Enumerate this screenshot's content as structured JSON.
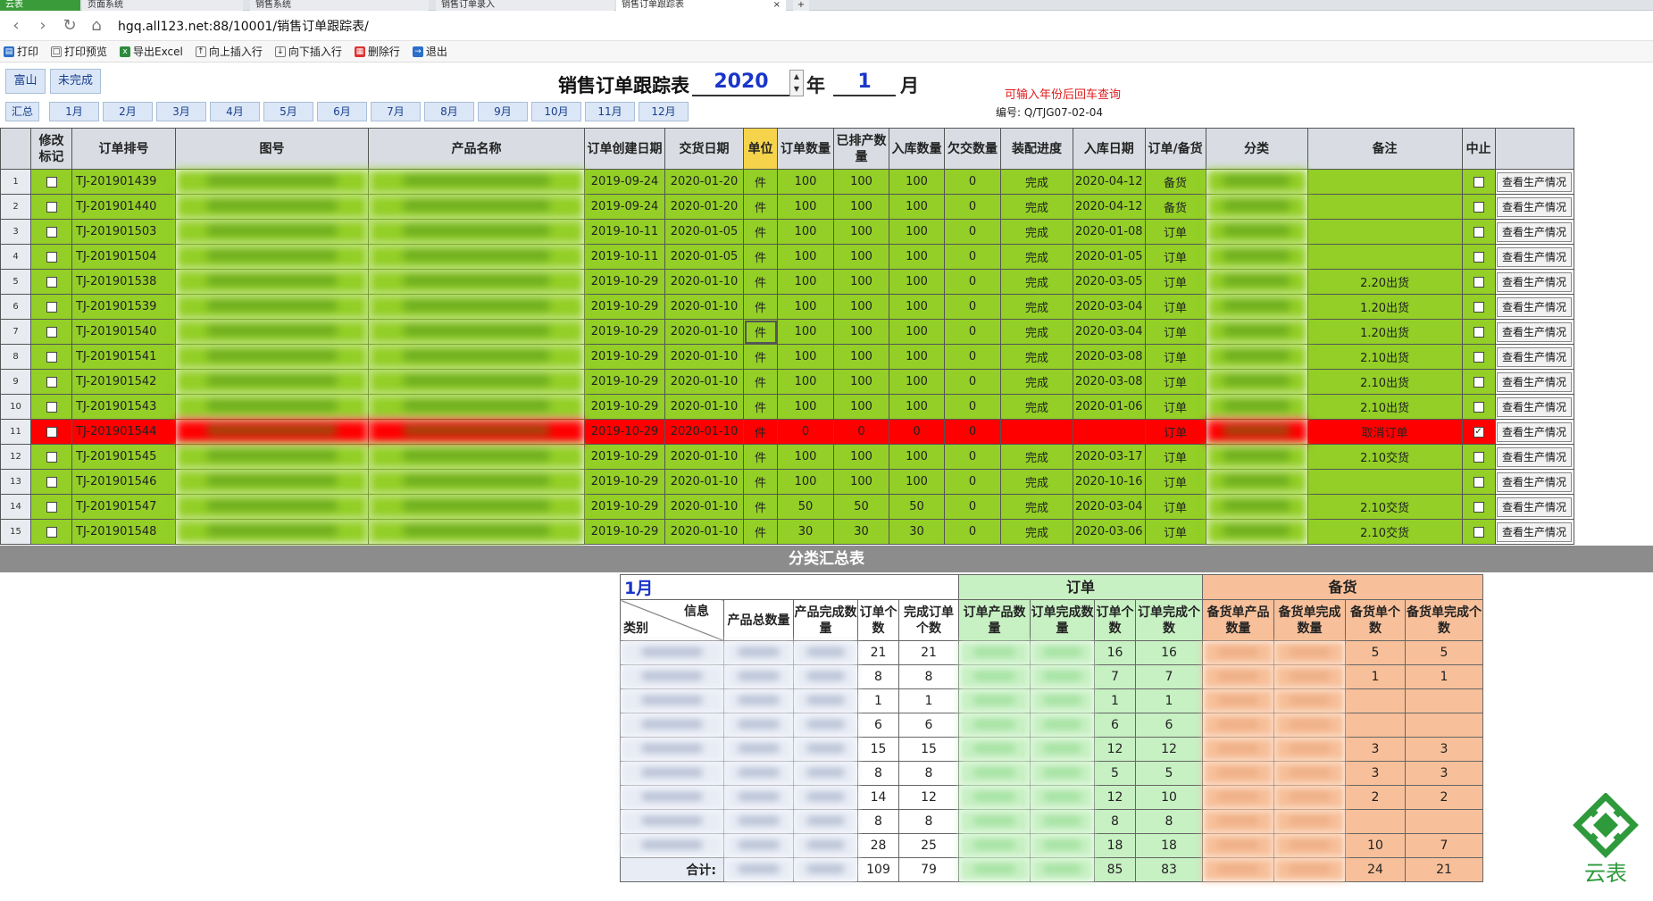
{
  "browser": {
    "tabs": [
      "云表",
      "页面系统",
      "销售系统",
      "销售订单录入",
      "销售订单跟踪表",
      "+"
    ],
    "url": "hgq.all123.net:88/10001/销售订单跟踪表/"
  },
  "toolbar": [
    "打印",
    "打印预览",
    "导出Excel",
    "向上插入行",
    "向下插入行",
    "删除行",
    "退出"
  ],
  "header": {
    "side_buttons": [
      "富山",
      "未完成"
    ],
    "summary_btn": "汇总",
    "months": [
      "1月",
      "2月",
      "3月",
      "4月",
      "5月",
      "6月",
      "7月",
      "8月",
      "9月",
      "10月",
      "11月",
      "12月"
    ],
    "title": "销售订单跟踪表",
    "year": "2020",
    "year_label": "年",
    "month": "1",
    "month_label": "月",
    "hint": "可输入年份后回车查询",
    "code_label": "编号:",
    "code": "Q/TJG07-02-04"
  },
  "table": {
    "columns": [
      "修改标记",
      "订单排号",
      "图号",
      "产品名称",
      "订单创建日期",
      "交货日期",
      "单位",
      "订单数量",
      "已排产数量",
      "入库数量",
      "欠交数量",
      "装配进度",
      "入库日期",
      "订单/备货",
      "分类",
      "备注",
      "中止"
    ],
    "rows": [
      {
        "n": "1",
        "id": "TJ-201901439",
        "created": "2019-09-24",
        "delivery": "2020-01-20",
        "unit": "件",
        "qty": "100",
        "sched": "100",
        "stock": "100",
        "owe": "0",
        "prog": "完成",
        "stockdate": "2020-04-12",
        "type": "备货",
        "note": "",
        "stop": false,
        "red": false
      },
      {
        "n": "2",
        "id": "TJ-201901440",
        "created": "2019-09-24",
        "delivery": "2020-01-20",
        "unit": "件",
        "qty": "100",
        "sched": "100",
        "stock": "100",
        "owe": "0",
        "prog": "完成",
        "stockdate": "2020-04-12",
        "type": "备货",
        "note": "",
        "stop": false,
        "red": false
      },
      {
        "n": "3",
        "id": "TJ-201901503",
        "created": "2019-10-11",
        "delivery": "2020-01-05",
        "unit": "件",
        "qty": "100",
        "sched": "100",
        "stock": "100",
        "owe": "0",
        "prog": "完成",
        "stockdate": "2020-01-08",
        "type": "订单",
        "note": "",
        "stop": false,
        "red": false
      },
      {
        "n": "4",
        "id": "TJ-201901504",
        "created": "2019-10-11",
        "delivery": "2020-01-05",
        "unit": "件",
        "qty": "100",
        "sched": "100",
        "stock": "100",
        "owe": "0",
        "prog": "完成",
        "stockdate": "2020-01-05",
        "type": "订单",
        "note": "",
        "stop": false,
        "red": false
      },
      {
        "n": "5",
        "id": "TJ-201901538",
        "created": "2019-10-29",
        "delivery": "2020-01-10",
        "unit": "件",
        "qty": "100",
        "sched": "100",
        "stock": "100",
        "owe": "0",
        "prog": "完成",
        "stockdate": "2020-03-05",
        "type": "订单",
        "note": "2.20出货",
        "stop": false,
        "red": false
      },
      {
        "n": "6",
        "id": "TJ-201901539",
        "created": "2019-10-29",
        "delivery": "2020-01-10",
        "unit": "件",
        "qty": "100",
        "sched": "100",
        "stock": "100",
        "owe": "0",
        "prog": "完成",
        "stockdate": "2020-03-04",
        "type": "订单",
        "note": "1.20出货",
        "stop": false,
        "red": false
      },
      {
        "n": "7",
        "id": "TJ-201901540",
        "created": "2019-10-29",
        "delivery": "2020-01-10",
        "unit": "件",
        "qty": "100",
        "sched": "100",
        "stock": "100",
        "owe": "0",
        "prog": "完成",
        "stockdate": "2020-03-04",
        "type": "订单",
        "note": "1.20出货",
        "stop": false,
        "red": false
      },
      {
        "n": "8",
        "id": "TJ-201901541",
        "created": "2019-10-29",
        "delivery": "2020-01-10",
        "unit": "件",
        "qty": "100",
        "sched": "100",
        "stock": "100",
        "owe": "0",
        "prog": "完成",
        "stockdate": "2020-03-08",
        "type": "订单",
        "note": "2.10出货",
        "stop": false,
        "red": false
      },
      {
        "n": "9",
        "id": "TJ-201901542",
        "created": "2019-10-29",
        "delivery": "2020-01-10",
        "unit": "件",
        "qty": "100",
        "sched": "100",
        "stock": "100",
        "owe": "0",
        "prog": "完成",
        "stockdate": "2020-03-08",
        "type": "订单",
        "note": "2.10出货",
        "stop": false,
        "red": false
      },
      {
        "n": "10",
        "id": "TJ-201901543",
        "created": "2019-10-29",
        "delivery": "2020-01-10",
        "unit": "件",
        "qty": "100",
        "sched": "100",
        "stock": "100",
        "owe": "0",
        "prog": "完成",
        "stockdate": "2020-01-06",
        "type": "订单",
        "note": "2.10出货",
        "stop": false,
        "red": false
      },
      {
        "n": "11",
        "id": "TJ-201901544",
        "created": "2019-10-29",
        "delivery": "2020-01-10",
        "unit": "件",
        "qty": "0",
        "sched": "0",
        "stock": "0",
        "owe": "0",
        "prog": "",
        "stockdate": "",
        "type": "订单",
        "note": "取消订单",
        "stop": true,
        "red": true
      },
      {
        "n": "12",
        "id": "TJ-201901545",
        "created": "2019-10-29",
        "delivery": "2020-01-10",
        "unit": "件",
        "qty": "100",
        "sched": "100",
        "stock": "100",
        "owe": "0",
        "prog": "完成",
        "stockdate": "2020-03-17",
        "type": "订单",
        "note": "2.10交货",
        "stop": false,
        "red": false
      },
      {
        "n": "13",
        "id": "TJ-201901546",
        "created": "2019-10-29",
        "delivery": "2020-01-10",
        "unit": "件",
        "qty": "100",
        "sched": "100",
        "stock": "100",
        "owe": "0",
        "prog": "完成",
        "stockdate": "2020-10-16",
        "type": "订单",
        "note": "",
        "stop": false,
        "red": false
      },
      {
        "n": "14",
        "id": "TJ-201901547",
        "created": "2019-10-29",
        "delivery": "2020-01-10",
        "unit": "件",
        "qty": "50",
        "sched": "50",
        "stock": "50",
        "owe": "0",
        "prog": "完成",
        "stockdate": "2020-03-04",
        "type": "订单",
        "note": "2.10交货",
        "stop": false,
        "red": false
      },
      {
        "n": "15",
        "id": "TJ-201901548",
        "created": "2019-10-29",
        "delivery": "2020-01-10",
        "unit": "件",
        "qty": "30",
        "sched": "30",
        "stock": "30",
        "owe": "0",
        "prog": "完成",
        "stockdate": "2020-03-06",
        "type": "订单",
        "note": "2.10交货",
        "stop": false,
        "red": false
      }
    ],
    "view_button": "查看生产情况"
  },
  "summary": {
    "bar_title": "分类汇总表",
    "month": "1月",
    "group_order": "订单",
    "group_stock": "备货",
    "diag_top": "信息",
    "diag_bottom": "类别",
    "cols": [
      "产品总数量",
      "产品完成数量",
      "订单个数",
      "完成订单个数",
      "订单产品数量",
      "订单完成数量",
      "订单个数",
      "订单完成个数",
      "备货单产品数量",
      "备货单完成数量",
      "备货单个数",
      "备货单完成个数"
    ],
    "rows": [
      {
        "oc": "21",
        "doc": "21",
        "o2": "16",
        "o2d": "16",
        "s": "5",
        "sd": "5"
      },
      {
        "oc": "8",
        "doc": "8",
        "o2": "7",
        "o2d": "7",
        "s": "1",
        "sd": "1"
      },
      {
        "oc": "1",
        "doc": "1",
        "o2": "1",
        "o2d": "1",
        "s": "",
        "sd": ""
      },
      {
        "oc": "6",
        "doc": "6",
        "o2": "6",
        "o2d": "6",
        "s": "",
        "sd": ""
      },
      {
        "oc": "15",
        "doc": "15",
        "o2": "12",
        "o2d": "12",
        "s": "3",
        "sd": "3"
      },
      {
        "oc": "8",
        "doc": "8",
        "o2": "5",
        "o2d": "5",
        "s": "3",
        "sd": "3"
      },
      {
        "oc": "14",
        "doc": "12",
        "o2": "12",
        "o2d": "10",
        "s": "2",
        "sd": "2"
      },
      {
        "oc": "8",
        "doc": "8",
        "o2": "8",
        "o2d": "8",
        "s": "",
        "sd": ""
      },
      {
        "oc": "28",
        "doc": "25",
        "o2": "18",
        "o2d": "18",
        "s": "10",
        "sd": "7"
      }
    ],
    "total_label": "合计:",
    "total": {
      "oc": "109",
      "doc": "79",
      "o2": "85",
      "o2d": "83",
      "s": "24",
      "sd": "21"
    }
  },
  "logo_text": "云表",
  "colors": {
    "row_green": "#93cf26",
    "row_red": "#ff0000",
    "order_green": "#c7f0c3",
    "stock_orange": "#f7c09a",
    "accent_blue": "#1a35c9"
  }
}
